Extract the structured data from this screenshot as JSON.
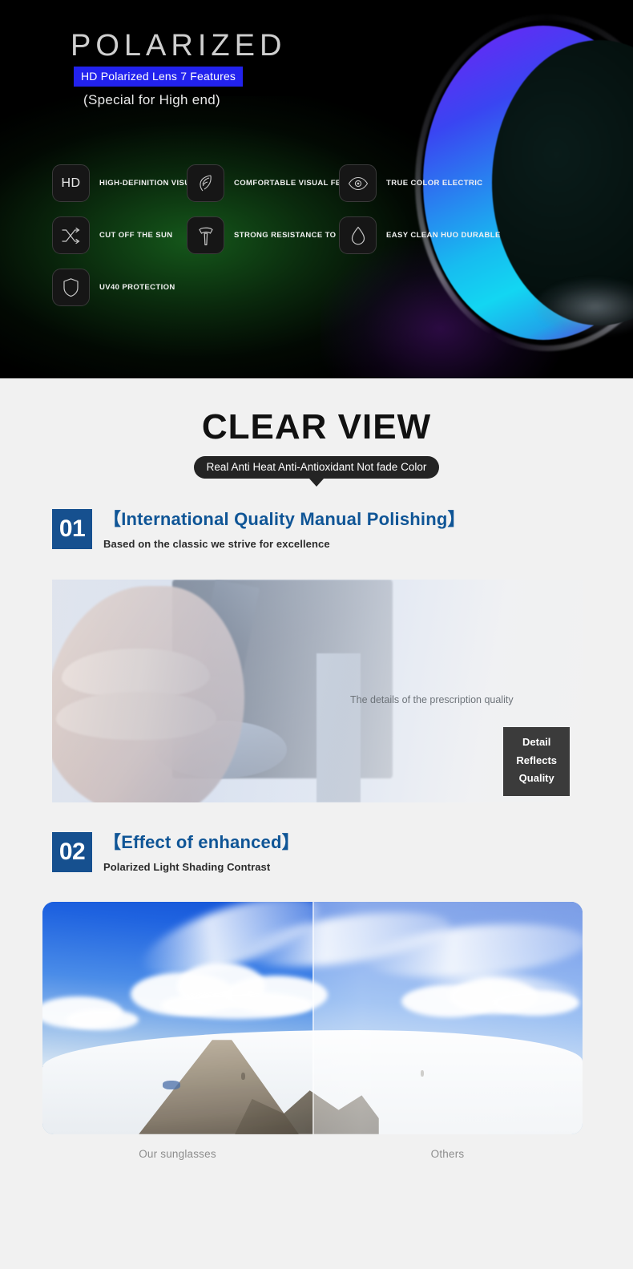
{
  "hero": {
    "title": "POLARIZED",
    "badge": "HD Polarized Lens 7 Features",
    "subtitle": "(Special for High end)",
    "badge_color": "#2222ee",
    "background_color": "#000000",
    "lens_gradient": [
      "#7b2ff7",
      "#3a45f2",
      "#17bdf0",
      "#13d6f2"
    ],
    "features": [
      {
        "icon": "hd-icon",
        "label": "HIGH-DEFINITION VISUAL"
      },
      {
        "icon": "leaf-icon",
        "label": "COMFORTABLE VISUAL FEELING"
      },
      {
        "icon": "eye-icon",
        "label": "TRUE COLOR ELECTRIC"
      },
      {
        "icon": "shuffle-arrows-icon",
        "label": "CUT OFF THE SUN"
      },
      {
        "icon": "hammer-icon",
        "label": "STRONG RESISTANCE TO IMPACT"
      },
      {
        "icon": "water-drop-icon",
        "label": "EASY CLEAN HUO DURABLE"
      },
      {
        "icon": "shield-icon",
        "label": "UV40 PROTECTION"
      }
    ],
    "hd_tile_text": "HD"
  },
  "clear_view": {
    "heading": "CLEAR VIEW",
    "pill": "Real Anti Heat Anti-Antioxidant Not fade Color",
    "pill_color": "#242424"
  },
  "sections": [
    {
      "number": "01",
      "title": "【International Quality Manual Polishing】",
      "subtitle": "Based on the classic we strive for excellence",
      "accent_color": "#16508f",
      "photo_caption": "The details of the prescription quality",
      "photo_box_lines": [
        "Detail",
        "Reflects",
        "Quality"
      ]
    },
    {
      "number": "02",
      "title": "【Effect of enhanced】",
      "subtitle": "Polarized Light Shading Contrast",
      "accent_color": "#16508f",
      "comparison_left_label": "Our sunglasses",
      "comparison_right_label": "Others"
    }
  ]
}
